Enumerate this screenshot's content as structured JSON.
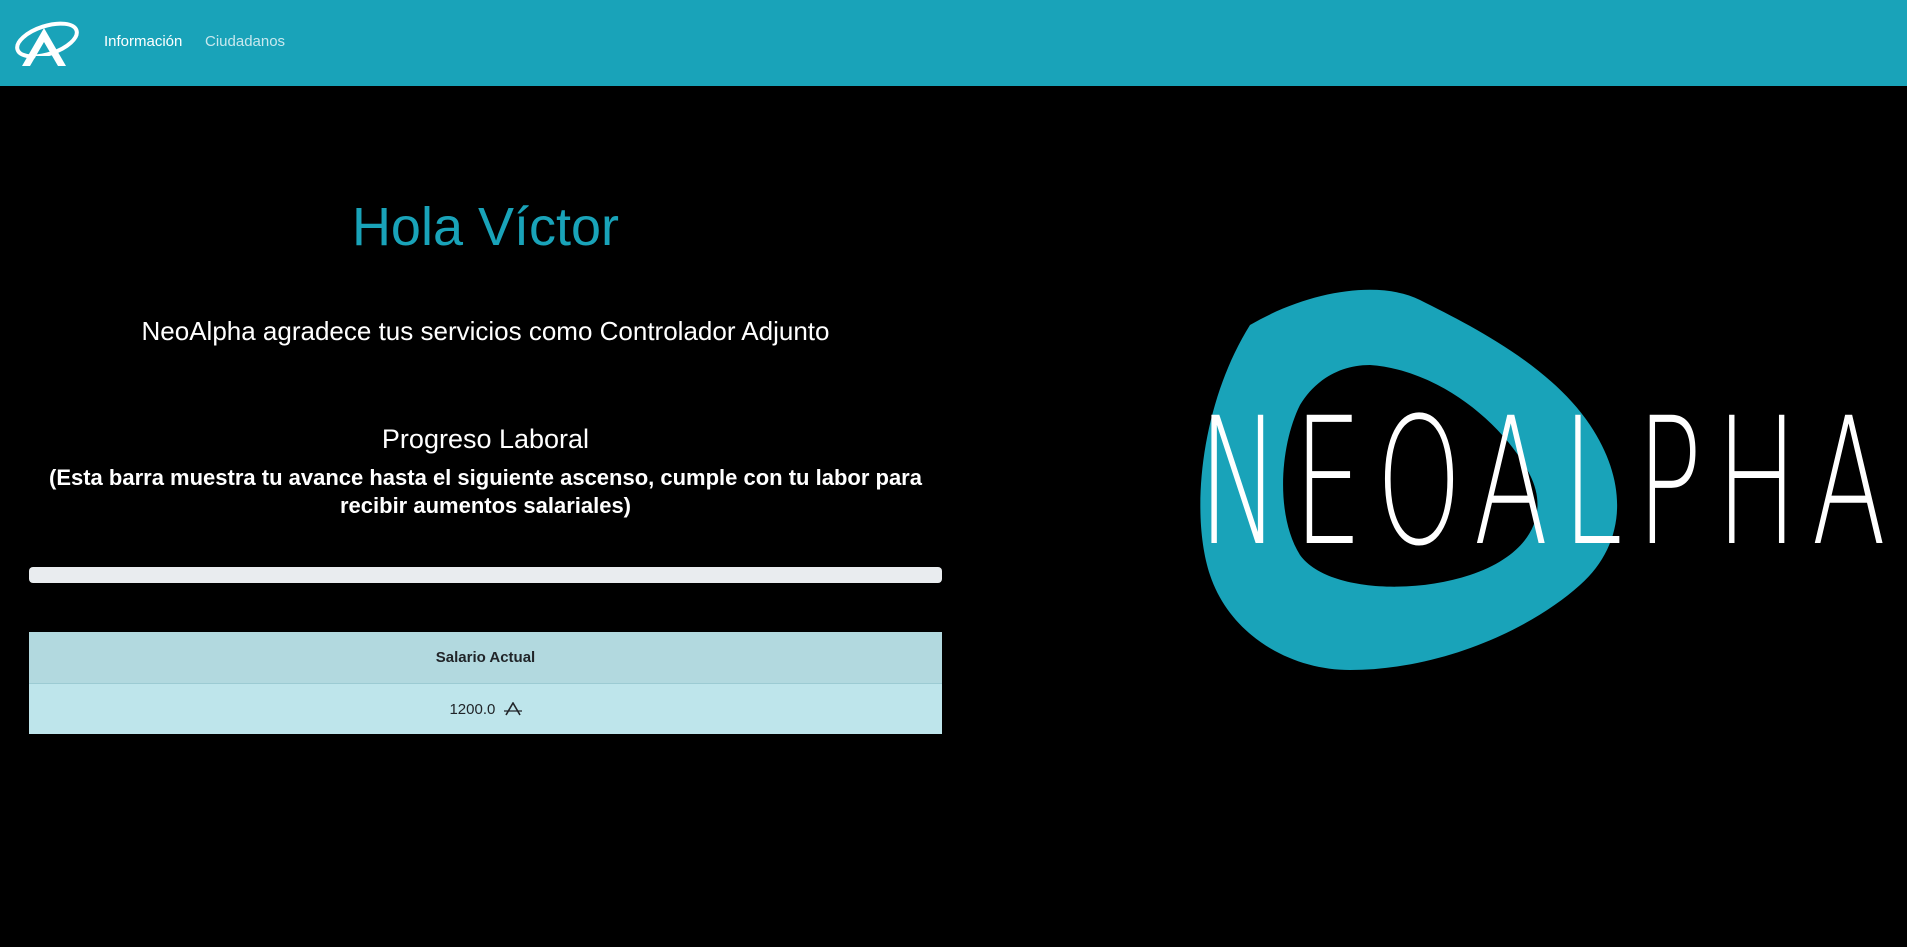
{
  "nav": {
    "logo_icon": "neoalpha-logo-icon",
    "links": [
      {
        "label": "Información",
        "active": true
      },
      {
        "label": "Ciudadanos",
        "active": false
      }
    ]
  },
  "main": {
    "greeting": "Hola Víctor",
    "thanks": "NeoAlpha agradece tus servicios como Controlador Adjunto",
    "progress_title": "Progreso Laboral",
    "progress_description": "(Esta barra muestra tu avance hasta el siguiente ascenso, cumple con tu labor para recibir aumentos salariales)",
    "progress_value": 0,
    "salary_table": {
      "header": "Salario Actual",
      "value": "1200.0",
      "currency_icon": "neoalpha-currency-icon"
    }
  },
  "brand": {
    "wordmark": "NEOALPHA",
    "emblem_icon": "brushstroke-ring-icon"
  },
  "colors": {
    "accent": "#19a3b9",
    "background": "#000000",
    "table_header": "#b2d9df",
    "table_row": "#bee5eb",
    "progress_track": "#e9ecef"
  }
}
